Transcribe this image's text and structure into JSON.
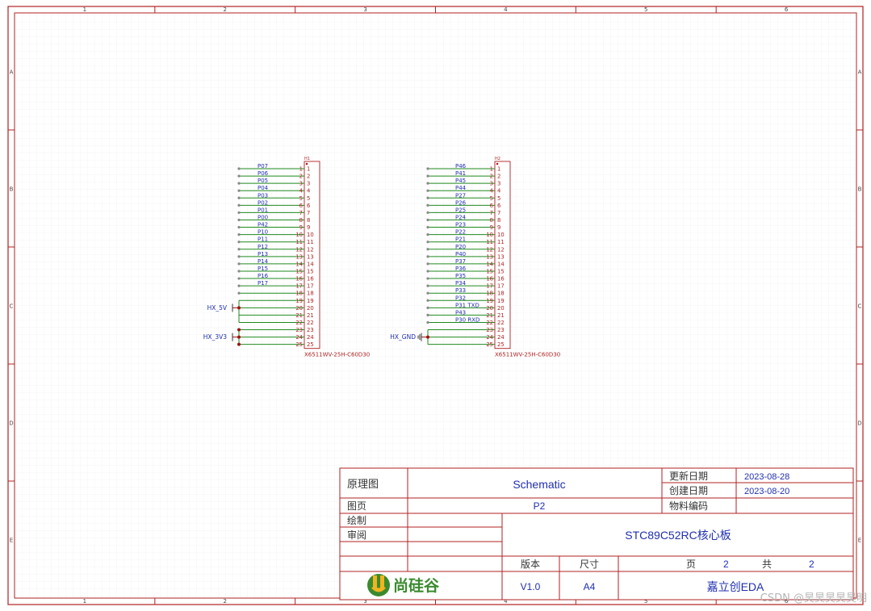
{
  "frame": {
    "col_labels": [
      "1",
      "2",
      "3",
      "4",
      "5",
      "6"
    ],
    "row_labels": [
      "A",
      "B",
      "C",
      "D",
      "E"
    ]
  },
  "colors": {
    "border": "#b02020",
    "wire": "#1f8a1f",
    "net_text": "#1f2fb0",
    "pin_text": "#b02020",
    "grid": "#e6e6e6",
    "logo_green": "#3a8a2e",
    "logo_yellow": "#f2b41f"
  },
  "connectors": [
    {
      "id": "left",
      "designator": "H1",
      "part": "X6511WV-25H-C60D30",
      "pins": [
        {
          "n": "1",
          "net": "P07"
        },
        {
          "n": "2",
          "net": "P06"
        },
        {
          "n": "3",
          "net": "P05"
        },
        {
          "n": "4",
          "net": "P04"
        },
        {
          "n": "5",
          "net": "P03"
        },
        {
          "n": "6",
          "net": "P02"
        },
        {
          "n": "7",
          "net": "P01"
        },
        {
          "n": "8",
          "net": "P00"
        },
        {
          "n": "9",
          "net": "P42"
        },
        {
          "n": "10",
          "net": "P10"
        },
        {
          "n": "11",
          "net": "P11"
        },
        {
          "n": "12",
          "net": "P12"
        },
        {
          "n": "13",
          "net": "P13"
        },
        {
          "n": "14",
          "net": "P14"
        },
        {
          "n": "15",
          "net": "P15"
        },
        {
          "n": "16",
          "net": "P16"
        },
        {
          "n": "17",
          "net": "P17"
        },
        {
          "n": "18",
          "net": ""
        },
        {
          "n": "19",
          "net": ""
        },
        {
          "n": "20",
          "net": ""
        },
        {
          "n": "21",
          "net": ""
        },
        {
          "n": "22",
          "net": ""
        },
        {
          "n": "23",
          "net": ""
        },
        {
          "n": "24",
          "net": ""
        },
        {
          "n": "25",
          "net": ""
        }
      ],
      "power": [
        {
          "label": "HX_5V",
          "pins": [
            19,
            22
          ]
        },
        {
          "label": "HX_3V3",
          "pins": [
            23,
            25
          ]
        }
      ]
    },
    {
      "id": "right",
      "designator": "H2",
      "part": "X6511WV-25H-C60D30",
      "pins": [
        {
          "n": "1",
          "net": "P46"
        },
        {
          "n": "2",
          "net": "P41"
        },
        {
          "n": "3",
          "net": "P45"
        },
        {
          "n": "4",
          "net": "P44"
        },
        {
          "n": "5",
          "net": "P27"
        },
        {
          "n": "6",
          "net": "P26"
        },
        {
          "n": "7",
          "net": "P25"
        },
        {
          "n": "8",
          "net": "P24"
        },
        {
          "n": "9",
          "net": "P23"
        },
        {
          "n": "10",
          "net": "P22"
        },
        {
          "n": "11",
          "net": "P21"
        },
        {
          "n": "12",
          "net": "P20"
        },
        {
          "n": "13",
          "net": "P40"
        },
        {
          "n": "14",
          "net": "P37"
        },
        {
          "n": "15",
          "net": "P36"
        },
        {
          "n": "16",
          "net": "P35"
        },
        {
          "n": "17",
          "net": "P34"
        },
        {
          "n": "18",
          "net": "P33"
        },
        {
          "n": "19",
          "net": "P32"
        },
        {
          "n": "20",
          "net": "P31_TXD"
        },
        {
          "n": "21",
          "net": "P43"
        },
        {
          "n": "22",
          "net": "P30_RXD"
        },
        {
          "n": "23",
          "net": ""
        },
        {
          "n": "24",
          "net": ""
        },
        {
          "n": "25",
          "net": ""
        }
      ],
      "power": [
        {
          "label": "HX_GND",
          "pins": [
            23,
            25
          ]
        }
      ]
    }
  ],
  "title_block": {
    "label_schematic_cn": "原理图",
    "schematic": "Schematic",
    "label_updated": "更新日期",
    "updated_date": "2023-08-28",
    "label_created": "创建日期",
    "created_date": "2023-08-20",
    "label_page": "图页",
    "page_name": "P2",
    "label_part_no": "物料编码",
    "part_no": "",
    "label_drawn": "绘制",
    "label_review": "审阅",
    "project": "STC89C52RC核心板",
    "label_version": "版本",
    "label_size": "尺寸",
    "label_page_num": "页",
    "page_num": "2",
    "label_total": "共",
    "total": "2",
    "logo_text": "尚硅谷",
    "version": "V1.0",
    "size": "A4",
    "company": "嘉立创EDA"
  },
  "watermark": "CSDN @昊昊昊昊昊明"
}
